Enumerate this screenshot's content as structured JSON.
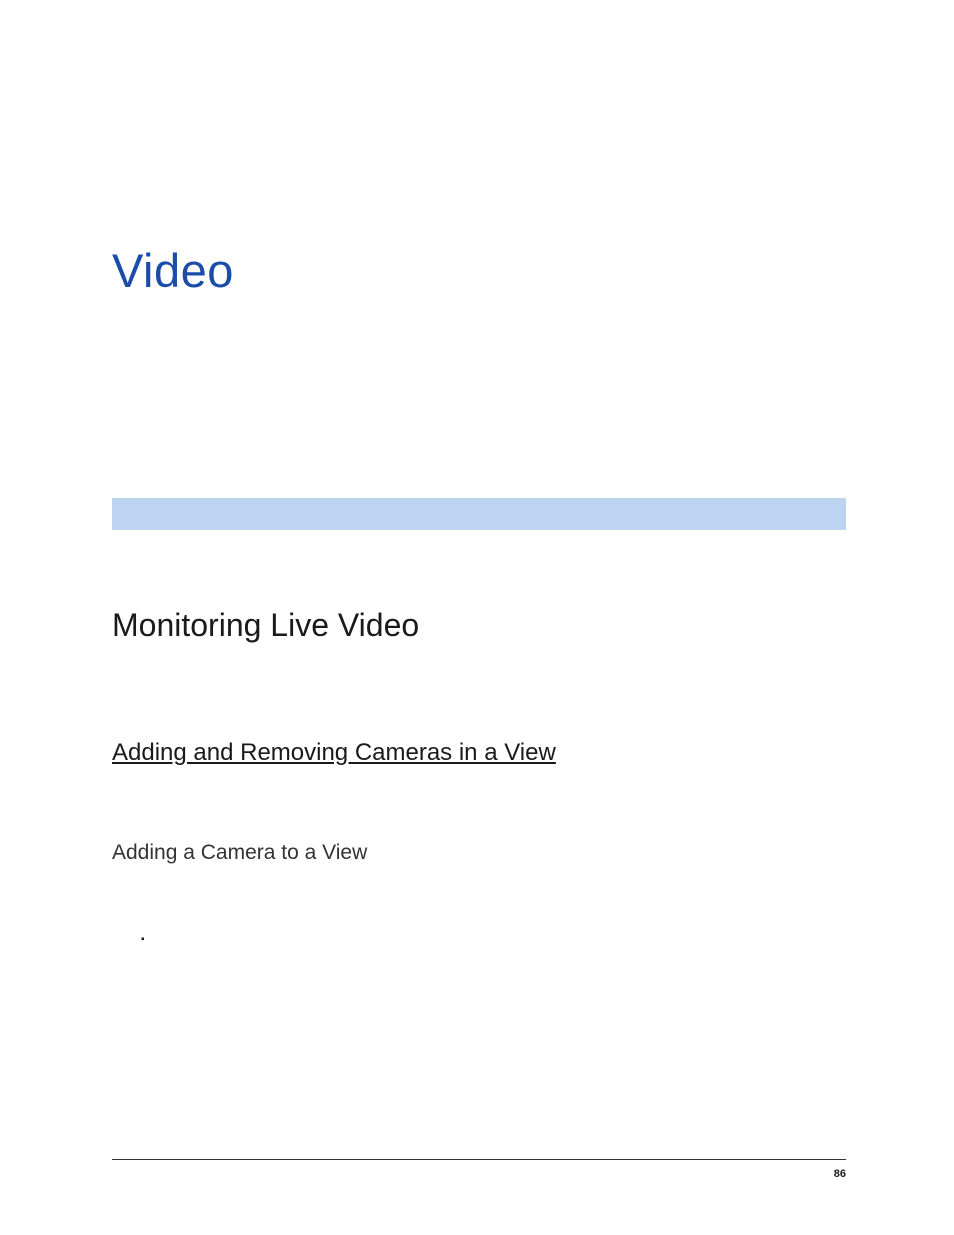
{
  "chapter": {
    "title": "Video"
  },
  "section": {
    "heading": "Monitoring Live Video"
  },
  "subsection": {
    "heading": "Adding and Removing Cameras in a View"
  },
  "subsubsection": {
    "heading": "Adding a Camera to a View"
  },
  "bullets": {
    "items": [
      "",
      "",
      ""
    ]
  },
  "footer": {
    "page_number": "86"
  }
}
